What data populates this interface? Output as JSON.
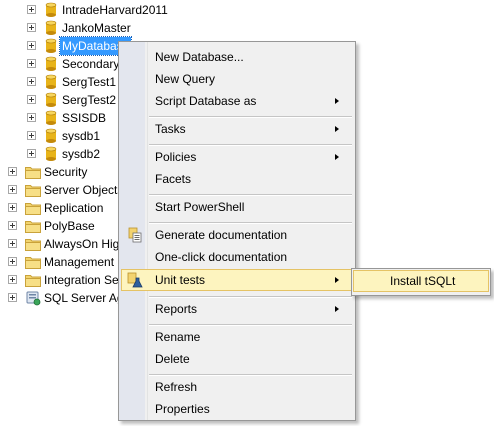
{
  "tree": {
    "databases": [
      {
        "label": "IntradeHarvard2011"
      },
      {
        "label": "JankoMaster"
      },
      {
        "label": "MyDatabase"
      },
      {
        "label": "Secondary"
      },
      {
        "label": "SergTest1"
      },
      {
        "label": "SergTest2"
      },
      {
        "label": "SSISDB"
      },
      {
        "label": "sysdb1"
      },
      {
        "label": "sysdb2"
      }
    ],
    "folders": [
      {
        "label": "Security"
      },
      {
        "label": "Server Objects"
      },
      {
        "label": "Replication"
      },
      {
        "label": "PolyBase"
      },
      {
        "label": "AlwaysOn High Availability"
      },
      {
        "label": "Management"
      },
      {
        "label": "Integration Services Catalogs"
      },
      {
        "label": "SQL Server Agent"
      }
    ]
  },
  "context_menu": {
    "items": {
      "new_database": "New Database...",
      "new_query": "New Query",
      "script_database_as": "Script Database as",
      "tasks": "Tasks",
      "policies": "Policies",
      "facets": "Facets",
      "start_powershell": "Start PowerShell",
      "generate_documentation": "Generate documentation",
      "one_click_documentation": "One-click documentation",
      "unit_tests": "Unit tests",
      "reports": "Reports",
      "rename": "Rename",
      "delete": "Delete",
      "refresh": "Refresh",
      "properties": "Properties"
    }
  },
  "submenu": {
    "install_tsqlt": "Install tSQLt"
  },
  "colors": {
    "selection": "#3399ff",
    "menu_highlight": "#fdf4bf",
    "menu_highlight_border": "#e5c365",
    "database_icon": "#e8b41a",
    "folder_icon": "#f2d46e"
  }
}
